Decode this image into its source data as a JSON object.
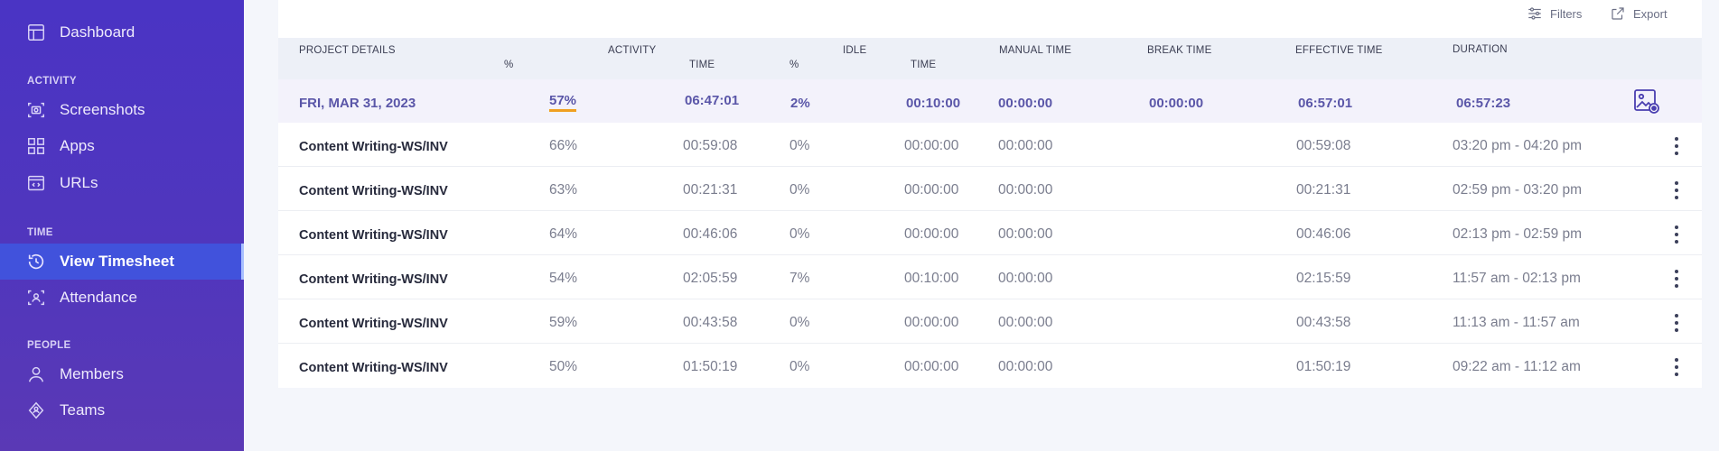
{
  "sidebar": {
    "dashboard": {
      "label": "Dashboard",
      "icon": "dashboard-icon"
    },
    "sections": {
      "activity": "ACTIVITY",
      "time": "TIME",
      "people": "PEOPLE"
    },
    "screenshots": {
      "label": "Screenshots",
      "icon": "camera-icon"
    },
    "apps": {
      "label": "Apps",
      "icon": "apps-grid-icon"
    },
    "urls": {
      "label": "URLs",
      "icon": "browser-code-icon"
    },
    "view_timesheet": {
      "label": "View Timesheet",
      "icon": "clock-history-icon",
      "active": true
    },
    "attendance": {
      "label": "Attendance",
      "icon": "attendance-scan-icon"
    },
    "members": {
      "label": "Members",
      "icon": "user-icon"
    },
    "teams": {
      "label": "Teams",
      "icon": "teams-icon"
    }
  },
  "toolbar": {
    "filters_label": "Filters",
    "export_label": "Export"
  },
  "table": {
    "headers": {
      "project_details": "PROJECT DETAILS",
      "activity": "ACTIVITY",
      "activity_pct": "%",
      "activity_time": "TIME",
      "idle": "IDLE",
      "idle_pct": "%",
      "idle_time": "TIME",
      "manual_time": "MANUAL TIME",
      "break_time": "BREAK TIME",
      "effective_time": "EFFECTIVE TIME",
      "duration": "DURATION"
    },
    "summary": {
      "date": "FRI, MAR 31, 2023",
      "activity_pct": "57%",
      "activity_time": "06:47:01",
      "idle_pct": "2%",
      "idle_time": "00:10:00",
      "manual_time": "00:00:00",
      "break_time": "00:00:00",
      "effective_time": "06:57:01",
      "duration": "06:57:23"
    },
    "rows": [
      {
        "project": "Content Writing-WS/INV",
        "activity_pct": "66%",
        "activity_time": "00:59:08",
        "idle_pct": "0%",
        "idle_time": "00:00:00",
        "manual_time": "00:00:00",
        "effective_time": "00:59:08",
        "duration": "03:20 pm - 04:20 pm"
      },
      {
        "project": "Content Writing-WS/INV",
        "activity_pct": "63%",
        "activity_time": "00:21:31",
        "idle_pct": "0%",
        "idle_time": "00:00:00",
        "manual_time": "00:00:00",
        "effective_time": "00:21:31",
        "duration": "02:59 pm - 03:20 pm"
      },
      {
        "project": "Content Writing-WS/INV",
        "activity_pct": "64%",
        "activity_time": "00:46:06",
        "idle_pct": "0%",
        "idle_time": "00:00:00",
        "manual_time": "00:00:00",
        "effective_time": "00:46:06",
        "duration": "02:13 pm - 02:59 pm"
      },
      {
        "project": "Content Writing-WS/INV",
        "activity_pct": "54%",
        "activity_time": "02:05:59",
        "idle_pct": "7%",
        "idle_time": "00:10:00",
        "manual_time": "00:00:00",
        "effective_time": "02:15:59",
        "duration": "11:57 am - 02:13 pm"
      },
      {
        "project": "Content Writing-WS/INV",
        "activity_pct": "59%",
        "activity_time": "00:43:58",
        "idle_pct": "0%",
        "idle_time": "00:00:00",
        "manual_time": "00:00:00",
        "effective_time": "00:43:58",
        "duration": "11:13 am - 11:57 am"
      },
      {
        "project": "Content Writing-WS/INV",
        "activity_pct": "50%",
        "activity_time": "01:50:19",
        "idle_pct": "0%",
        "idle_time": "00:00:00",
        "manual_time": "00:00:00",
        "effective_time": "01:50:19",
        "duration": "09:22 am - 11:12 am"
      }
    ]
  },
  "colors": {
    "sidebar_top": "#4a34c4",
    "sidebar_bottom": "#5a39b5",
    "active_item": "#4152dc",
    "accent_underline": "#f0a020",
    "summary_text": "#5a56a8"
  }
}
